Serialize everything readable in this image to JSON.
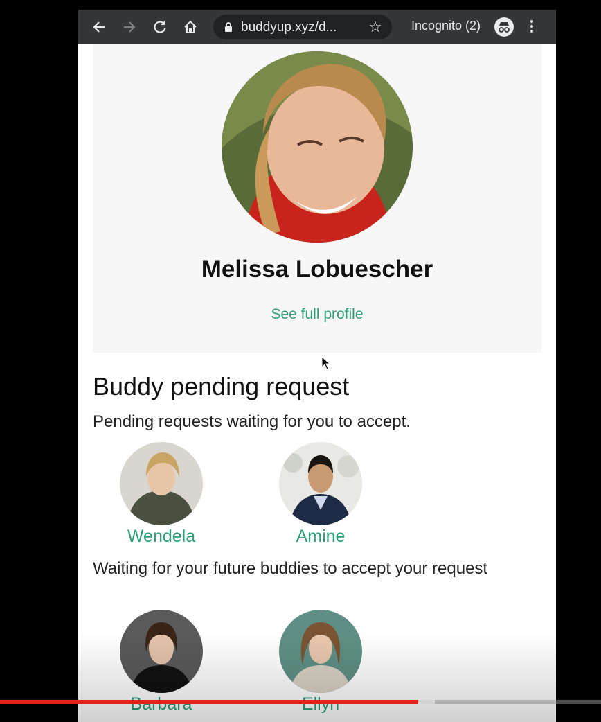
{
  "browser": {
    "url": "buddyup.xyz/d...",
    "incognito_label": "Incognito (2)",
    "icons": [
      "back-arrow-icon",
      "forward-arrow-icon",
      "reload-icon",
      "home-icon",
      "lock-icon",
      "star-icon",
      "incognito-icon",
      "kebab-menu-icon"
    ]
  },
  "profile": {
    "name": "Melissa Lobuescher",
    "link_label": "See full profile"
  },
  "pending": {
    "title": "Buddy pending request",
    "incoming_text": "Pending requests waiting for you to accept.",
    "incoming": [
      {
        "name": "Wendela"
      },
      {
        "name": "Amine"
      }
    ],
    "outgoing_text": "Waiting for your future buddies to accept your request",
    "outgoing": [
      {
        "name": "Barbara"
      },
      {
        "name": "Ellyn"
      }
    ]
  },
  "video": {
    "progress": 0.696,
    "buffered": 0.724
  },
  "colors": {
    "accent": "#2a9d79",
    "toolbar": "#35363a",
    "progress": "#e62117"
  }
}
